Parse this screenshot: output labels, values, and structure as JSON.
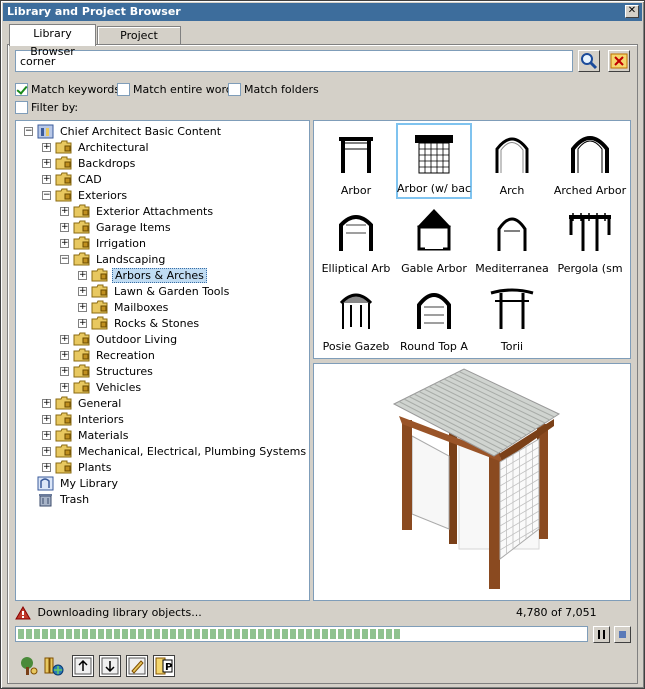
{
  "window": {
    "title": "Library and Project Browser"
  },
  "tabs": [
    {
      "label": "Library Browser",
      "active": true
    },
    {
      "label": "Project Browser",
      "active": false
    }
  ],
  "search": {
    "value": "corner"
  },
  "options": {
    "match_keywords": {
      "label": "Match keywords",
      "checked": true
    },
    "match_entire_word": {
      "label": "Match entire word",
      "checked": false
    },
    "match_folders": {
      "label": "Match folders",
      "checked": false
    },
    "filter_by": {
      "label": "Filter by:",
      "checked": false
    }
  },
  "tree": [
    {
      "label": "Chief Architect Basic Content",
      "level": 0,
      "expander": "−",
      "icon": "library-icon"
    },
    {
      "label": "Architectural",
      "level": 1,
      "expander": "+",
      "icon": "folder-icon"
    },
    {
      "label": "Backdrops",
      "level": 1,
      "expander": "+",
      "icon": "folder-icon"
    },
    {
      "label": "CAD",
      "level": 1,
      "expander": "+",
      "icon": "folder-icon"
    },
    {
      "label": "Exteriors",
      "level": 1,
      "expander": "−",
      "icon": "folder-icon"
    },
    {
      "label": "Exterior Attachments",
      "level": 2,
      "expander": "+",
      "icon": "folder-icon"
    },
    {
      "label": "Garage Items",
      "level": 2,
      "expander": "+",
      "icon": "folder-icon"
    },
    {
      "label": "Irrigation",
      "level": 2,
      "expander": "+",
      "icon": "folder-icon"
    },
    {
      "label": "Landscaping",
      "level": 2,
      "expander": "−",
      "icon": "folder-icon"
    },
    {
      "label": "Arbors & Arches",
      "level": 3,
      "expander": "+",
      "icon": "folder-icon",
      "selected": true
    },
    {
      "label": "Lawn & Garden Tools",
      "level": 3,
      "expander": "+",
      "icon": "folder-icon"
    },
    {
      "label": "Mailboxes",
      "level": 3,
      "expander": "+",
      "icon": "folder-icon"
    },
    {
      "label": "Rocks & Stones",
      "level": 3,
      "expander": "+",
      "icon": "folder-icon"
    },
    {
      "label": "Outdoor Living",
      "level": 2,
      "expander": "+",
      "icon": "folder-icon"
    },
    {
      "label": "Recreation",
      "level": 2,
      "expander": "+",
      "icon": "folder-icon"
    },
    {
      "label": "Structures",
      "level": 2,
      "expander": "+",
      "icon": "folder-icon"
    },
    {
      "label": "Vehicles",
      "level": 2,
      "expander": "+",
      "icon": "folder-icon"
    },
    {
      "label": "General",
      "level": 1,
      "expander": "+",
      "icon": "folder-icon"
    },
    {
      "label": "Interiors",
      "level": 1,
      "expander": "+",
      "icon": "folder-icon"
    },
    {
      "label": "Materials",
      "level": 1,
      "expander": "+",
      "icon": "folder-icon"
    },
    {
      "label": "Mechanical, Electrical, Plumbing Systems",
      "level": 1,
      "expander": "+",
      "icon": "folder-icon"
    },
    {
      "label": "Plants",
      "level": 1,
      "expander": "+",
      "icon": "folder-icon"
    },
    {
      "label": "My Library",
      "level": 0,
      "expander": "",
      "icon": "my-library-icon"
    },
    {
      "label": "Trash",
      "level": 0,
      "expander": "",
      "icon": "trash-icon"
    }
  ],
  "grid_items": [
    {
      "label": "Arbor",
      "icon": "arbor-icon"
    },
    {
      "label": "Arbor (w/ bac",
      "icon": "arbor-back-icon",
      "selected": true
    },
    {
      "label": "Arch",
      "icon": "arch-icon"
    },
    {
      "label": "Arched Arbor",
      "icon": "arched-arbor-icon"
    },
    {
      "label": "Elliptical Arb",
      "icon": "elliptical-arbor-icon"
    },
    {
      "label": "Gable Arbor",
      "icon": "gable-arbor-icon"
    },
    {
      "label": "Mediterranea",
      "icon": "mediterranean-arch-icon"
    },
    {
      "label": "Pergola (sm",
      "icon": "pergola-icon"
    },
    {
      "label": "Posie Gazeb",
      "icon": "gazebo-icon"
    },
    {
      "label": "Round Top A",
      "icon": "round-top-arbor-icon"
    },
    {
      "label": "Torii",
      "icon": "torii-icon"
    }
  ],
  "status": {
    "message": "Downloading library objects...",
    "count": "4,780 of 7,051",
    "progress_fraction": 0.678
  },
  "colors": {
    "selection": "#c0dcf3",
    "folder": "#e8c860",
    "progress": "#8fc28f",
    "wood": "#8a4a20",
    "roof": "#c8ccc8"
  }
}
